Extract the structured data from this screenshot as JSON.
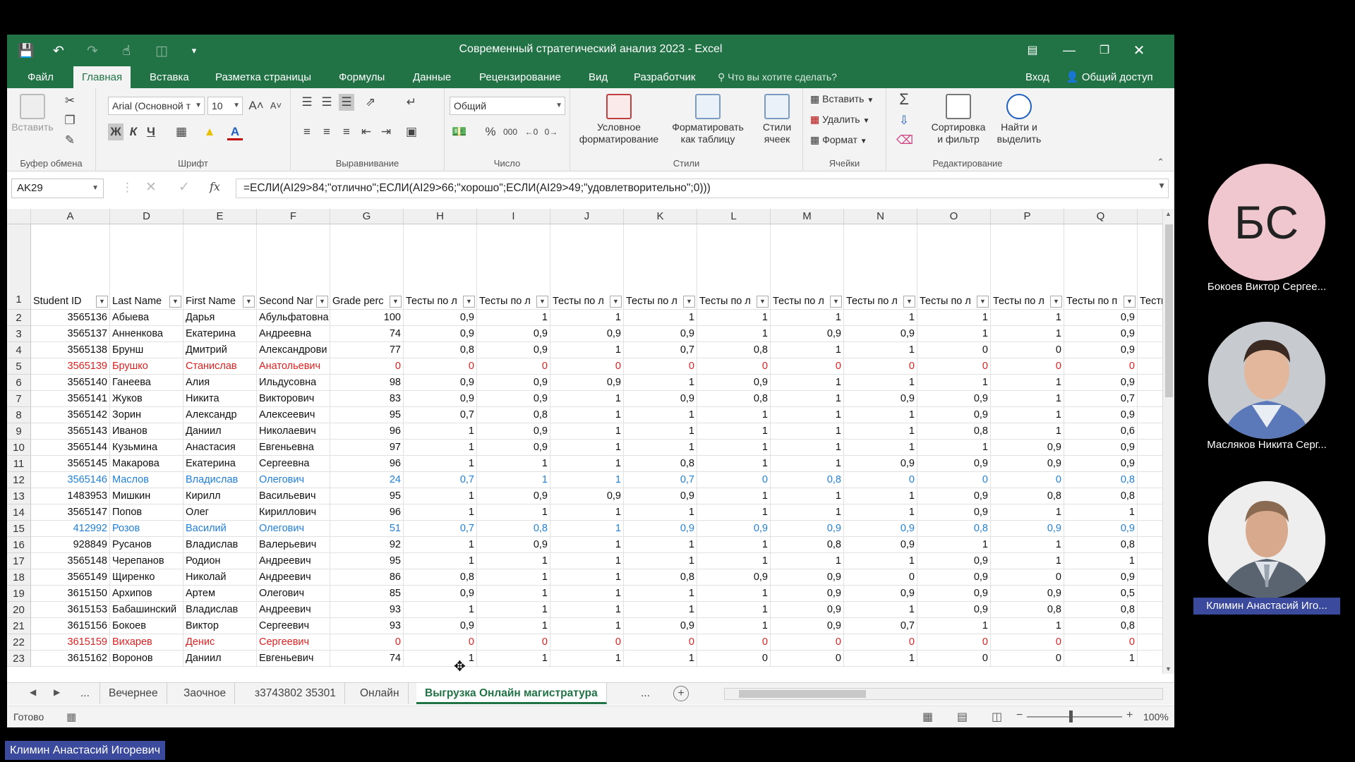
{
  "window": {
    "title": "Современный стратегический анализ 2023 - Excel",
    "accent": "#217346"
  },
  "ribbon": {
    "tabs": [
      "Файл",
      "Главная",
      "Вставка",
      "Разметка страницы",
      "Формулы",
      "Данные",
      "Рецензирование",
      "Вид",
      "Разработчик"
    ],
    "active_tab": "Главная",
    "tell_me": "Что вы хотите сделать?",
    "sign_in": "Вход",
    "share": "Общий доступ",
    "clipboard": {
      "paste": "Вставить",
      "label": "Буфер обмена"
    },
    "font": {
      "name": "Arial (Основной т",
      "size": "10",
      "bold": "Ж",
      "italic": "К",
      "underline": "Ч",
      "label": "Шрифт"
    },
    "alignment": {
      "label": "Выравнивание"
    },
    "number": {
      "format": "Общий",
      "percent": "%",
      "thousands": "000",
      "label": "Число"
    },
    "styles": {
      "conditional": "Условное форматирование",
      "as_table": "Форматировать как таблицу",
      "cell_styles": "Стили ячеек",
      "label": "Стили"
    },
    "cells": {
      "insert": "Вставить",
      "delete": "Удалить",
      "format": "Формат",
      "label": "Ячейки"
    },
    "editing": {
      "sort": "Сортировка и фильтр",
      "find": "Найти и выделить",
      "label": "Редактирование"
    }
  },
  "formula_bar": {
    "name_box": "AK29",
    "fx": "fx",
    "formula": "=ЕСЛИ(AI29>84;\"отлично\";ЕСЛИ(AI29>66;\"хорошо\";ЕСЛИ(AI29>49;\"удовлетворительно\";0)))"
  },
  "grid": {
    "columns": [
      "A",
      "D",
      "E",
      "F",
      "G",
      "H",
      "I",
      "J",
      "K",
      "L",
      "M",
      "N",
      "O",
      "P",
      "Q"
    ],
    "headers": [
      "Student ID",
      "Last Name",
      "First Name",
      "Second Nar",
      "Grade perc",
      "Тесты по л",
      "Тесты по л",
      "Тесты по л",
      "Тесты по л",
      "Тесты по л",
      "Тесты по л",
      "Тесты по л",
      "Тесты по л",
      "Тесты по л",
      "Тесты по п",
      "Тесты"
    ],
    "rows": [
      {
        "n": "2",
        "style": "",
        "v": [
          "3565136",
          "Абыева",
          "Дарья",
          "Абульфатовна",
          "100",
          "0,9",
          "1",
          "1",
          "1",
          "1",
          "1",
          "1",
          "1",
          "1",
          "0,9"
        ]
      },
      {
        "n": "3",
        "style": "",
        "v": [
          "3565137",
          "Анненкова",
          "Екатерина",
          "Андреевна",
          "74",
          "0,9",
          "0,9",
          "0,9",
          "0,9",
          "1",
          "0,9",
          "0,9",
          "1",
          "1",
          "0,9"
        ]
      },
      {
        "n": "4",
        "style": "",
        "v": [
          "3565138",
          "Брунш",
          "Дмитрий",
          "Александрови",
          "77",
          "0,8",
          "0,9",
          "1",
          "0,7",
          "0,8",
          "1",
          "1",
          "0",
          "0",
          "0,9"
        ]
      },
      {
        "n": "5",
        "style": "red",
        "v": [
          "3565139",
          "Брушко",
          "Станислав",
          "Анатольевич",
          "0",
          "0",
          "0",
          "0",
          "0",
          "0",
          "0",
          "0",
          "0",
          "0",
          "0"
        ]
      },
      {
        "n": "6",
        "style": "",
        "v": [
          "3565140",
          "Ганеева",
          "Алия",
          "Ильдусовна",
          "98",
          "0,9",
          "0,9",
          "0,9",
          "1",
          "0,9",
          "1",
          "1",
          "1",
          "1",
          "0,9"
        ]
      },
      {
        "n": "7",
        "style": "",
        "v": [
          "3565141",
          "Жуков",
          "Никита",
          "Викторович",
          "83",
          "0,9",
          "0,9",
          "1",
          "0,9",
          "0,8",
          "1",
          "0,9",
          "0,9",
          "1",
          "0,7"
        ]
      },
      {
        "n": "8",
        "style": "",
        "v": [
          "3565142",
          "Зорин",
          "Александр",
          "Алексеевич",
          "95",
          "0,7",
          "0,8",
          "1",
          "1",
          "1",
          "1",
          "1",
          "0,9",
          "1",
          "0,9"
        ]
      },
      {
        "n": "9",
        "style": "",
        "v": [
          "3565143",
          "Иванов",
          "Даниил",
          "Николаевич",
          "96",
          "1",
          "0,9",
          "1",
          "1",
          "1",
          "1",
          "1",
          "0,8",
          "1",
          "0,6"
        ]
      },
      {
        "n": "10",
        "style": "",
        "v": [
          "3565144",
          "Кузьмина",
          "Анастасия",
          "Евгеньевна",
          "97",
          "1",
          "0,9",
          "1",
          "1",
          "1",
          "1",
          "1",
          "1",
          "0,9",
          "0,9"
        ]
      },
      {
        "n": "11",
        "style": "",
        "v": [
          "3565145",
          "Макарова",
          "Екатерина",
          "Сергеевна",
          "96",
          "1",
          "1",
          "1",
          "0,8",
          "1",
          "1",
          "0,9",
          "0,9",
          "0,9",
          "0,9"
        ]
      },
      {
        "n": "12",
        "style": "blue",
        "v": [
          "3565146",
          "Маслов",
          "Владислав",
          "Олегович",
          "24",
          "0,7",
          "1",
          "1",
          "0,7",
          "0",
          "0,8",
          "0",
          "0",
          "0",
          "0,8"
        ]
      },
      {
        "n": "13",
        "style": "",
        "v": [
          "1483953",
          "Мишкин",
          "Кирилл",
          "Васильевич",
          "95",
          "1",
          "0,9",
          "0,9",
          "0,9",
          "1",
          "1",
          "1",
          "0,9",
          "0,8",
          "0,8"
        ]
      },
      {
        "n": "14",
        "style": "",
        "v": [
          "3565147",
          "Попов",
          "Олег",
          "Кириллович",
          "96",
          "1",
          "1",
          "1",
          "1",
          "1",
          "1",
          "1",
          "0,9",
          "1",
          "1"
        ]
      },
      {
        "n": "15",
        "style": "blue",
        "v": [
          "412992",
          "Розов",
          "Василий",
          "Олегович",
          "51",
          "0,7",
          "0,8",
          "1",
          "0,9",
          "0,9",
          "0,9",
          "0,9",
          "0,8",
          "0,9",
          "0,9"
        ]
      },
      {
        "n": "16",
        "style": "",
        "v": [
          "928849",
          "Русанов",
          "Владислав",
          "Валерьевич",
          "92",
          "1",
          "0,9",
          "1",
          "1",
          "1",
          "0,8",
          "0,9",
          "1",
          "1",
          "0,8"
        ]
      },
      {
        "n": "17",
        "style": "",
        "v": [
          "3565148",
          "Черепанов",
          "Родион",
          "Андреевич",
          "95",
          "1",
          "1",
          "1",
          "1",
          "1",
          "1",
          "1",
          "0,9",
          "1",
          "1"
        ]
      },
      {
        "n": "18",
        "style": "",
        "v": [
          "3565149",
          "Щиренко",
          "Николай",
          "Андреевич",
          "86",
          "0,8",
          "1",
          "1",
          "0,8",
          "0,9",
          "0,9",
          "0",
          "0,9",
          "0",
          "0,9"
        ]
      },
      {
        "n": "19",
        "style": "",
        "v": [
          "3615150",
          "Архипов",
          "Артем",
          "Олегович",
          "85",
          "0,9",
          "1",
          "1",
          "1",
          "1",
          "0,9",
          "0,9",
          "0,9",
          "0,9",
          "0,5"
        ]
      },
      {
        "n": "20",
        "style": "",
        "v": [
          "3615153",
          "Бабашинский",
          "Владислав",
          "Андреевич",
          "93",
          "1",
          "1",
          "1",
          "1",
          "1",
          "0,9",
          "1",
          "0,9",
          "0,8",
          "0,8"
        ]
      },
      {
        "n": "21",
        "style": "",
        "v": [
          "3615156",
          "Бокоев",
          "Виктор",
          "Сергеевич",
          "93",
          "0,9",
          "1",
          "1",
          "0,9",
          "1",
          "0,9",
          "0,7",
          "1",
          "1",
          "0,8"
        ]
      },
      {
        "n": "22",
        "style": "red",
        "v": [
          "3615159",
          "Вихарев",
          "Денис",
          "Сергеевич",
          "0",
          "0",
          "0",
          "0",
          "0",
          "0",
          "0",
          "0",
          "0",
          "0",
          "0"
        ]
      },
      {
        "n": "23",
        "style": "",
        "v": [
          "3615162",
          "Воронов",
          "Даниил",
          "Евгеньевич",
          "74",
          "1",
          "1",
          "1",
          "1",
          "0",
          "0",
          "1",
          "0",
          "0",
          "1"
        ]
      }
    ]
  },
  "sheets": {
    "ellipsis": "...",
    "tabs": [
      "Вечернее",
      "Заочное",
      "з3743802 35301",
      "Онлайн",
      "Выгрузка Онлайн магистратура"
    ],
    "active": "Выгрузка Онлайн магистратура"
  },
  "status": {
    "ready": "Готово",
    "zoom": "100%"
  },
  "participants": [
    {
      "initials": "БС",
      "name": "Бокоев Виктор Сергее..."
    },
    {
      "name": "Масляков Никита Серг..."
    },
    {
      "name": "Климин Анастасий Иго..."
    }
  ],
  "speaker": "Климин Анастасий Игоревич"
}
